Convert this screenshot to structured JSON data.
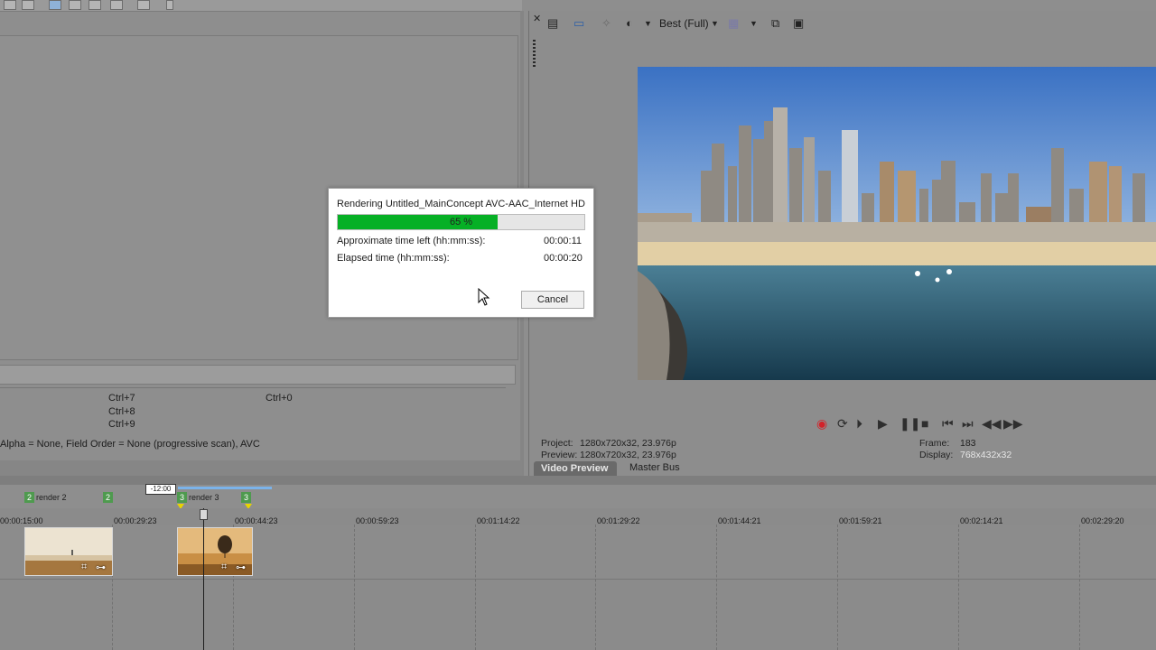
{
  "render_dialog": {
    "title": "Rendering Untitled_MainConcept AVC-AAC_Internet HD",
    "progress_percent": 65,
    "progress_label": "65 %",
    "time_left_label": "Approximate time left (hh:mm:ss):",
    "time_left_value": "00:00:11",
    "elapsed_label": "Elapsed time (hh:mm:ss):",
    "elapsed_value": "00:00:20",
    "cancel_label": "Cancel"
  },
  "left_panel": {
    "shortcuts": [
      "Ctrl+7",
      "Ctrl+8",
      "Ctrl+9",
      "Ctrl+0"
    ],
    "status": "Alpha = None, Field Order = None (progressive scan), AVC"
  },
  "preview": {
    "quality": "Best (Full)",
    "project_label": "Project:",
    "project_value": "1280x720x32, 23.976p",
    "preview_label": "Preview:",
    "preview_value": "1280x720x32, 23.976p",
    "frame_label": "Frame:",
    "frame_value": "183",
    "display_label": "Display:",
    "display_value": "768x432x32",
    "tabs": [
      "Video Preview",
      "Master Bus"
    ]
  },
  "timeline": {
    "timecode_box": "-12:00",
    "markers": [
      {
        "num": "2",
        "label": "render 2"
      },
      {
        "num": "2",
        "label": ""
      },
      {
        "num": "3",
        "label": "render 3"
      },
      {
        "num": "3",
        "label": ""
      }
    ],
    "ruler": [
      "00:00:15:00",
      "00:00:29:23",
      "00:00:44:23",
      "00:00:59:23",
      "00:01:14:22",
      "00:01:29:22",
      "00:01:44:21",
      "00:01:59:21",
      "00:02:14:21",
      "00:02:29:20"
    ]
  },
  "colors": {
    "progress_fill": "#06b025",
    "active_tab": "#6a6a6a",
    "marker_green": "#4f9a4f",
    "record_red": "#d2232a"
  }
}
